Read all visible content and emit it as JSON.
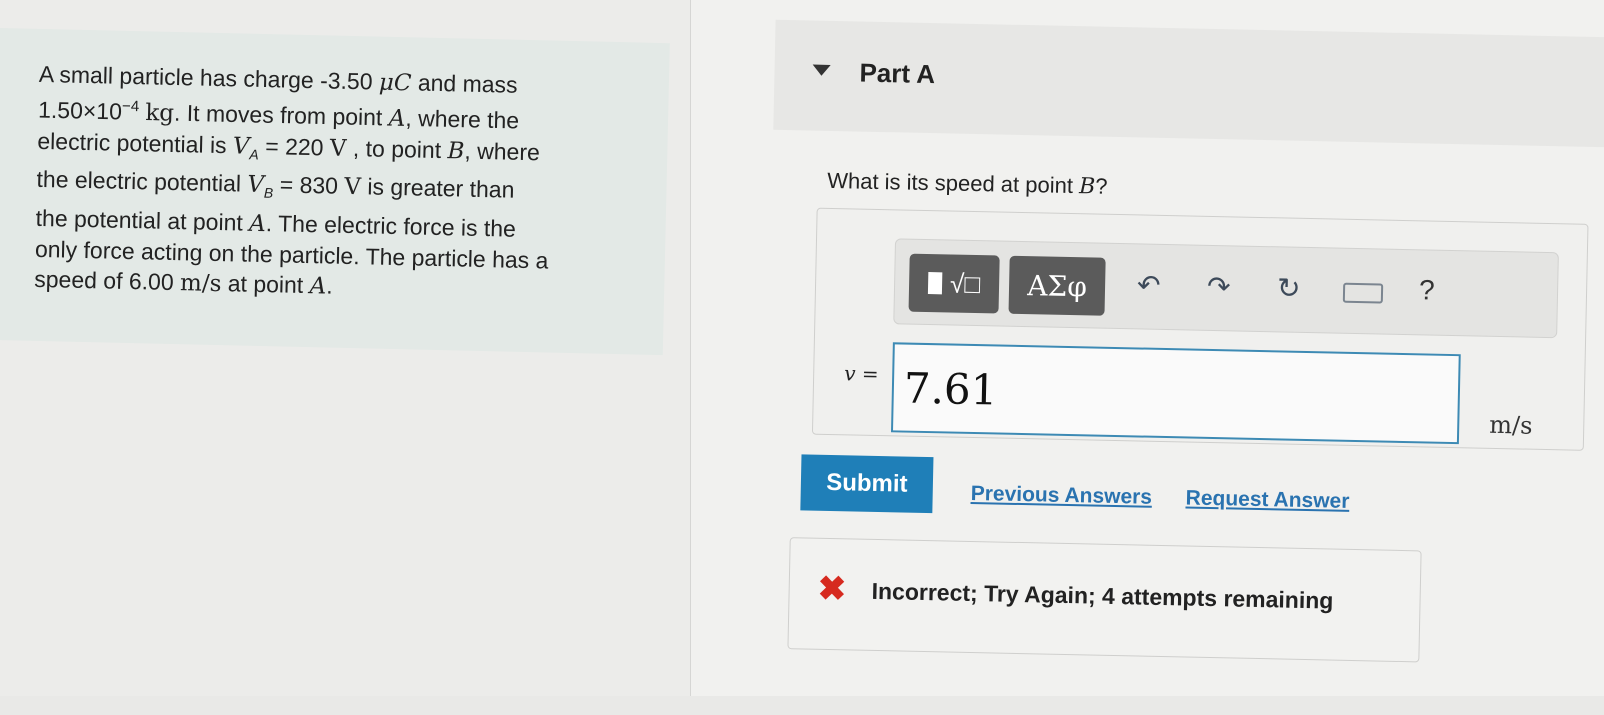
{
  "problem": {
    "line1": "A small particle has charge -3.50 ",
    "line1_unit": "μC",
    "line1_end": " and mass",
    "mass_value": "1.50×10",
    "mass_exp": "−4",
    "mass_unit": "kg",
    "line2_end": ". It moves from point ",
    "point_a": "A",
    "line2_tail": ", where the",
    "line3": "electric potential is ",
    "va_sym": "V",
    "va_sub": "A",
    "va_val": " = 220 ",
    "va_unit": "V",
    "line3_tail": " , to point ",
    "point_b": "B",
    "line3_end": ", where",
    "line4": "the electric potential ",
    "vb_sym": "V",
    "vb_sub": "B",
    "vb_val": " = 830 ",
    "vb_unit": "V",
    "line4_tail": " is greater than",
    "line5": "the potential at point ",
    "point_a2": "A",
    "line5_tail": ". The electric force is the",
    "line6": "only force acting on the particle. The particle has a",
    "line7": "speed of 6.00 ",
    "speed_unit": "m/s",
    "line7_tail": " at point ",
    "point_a3": "A",
    "line7_end": "."
  },
  "part": {
    "title": "Part A"
  },
  "question": {
    "text": "What is its speed at point ",
    "point": "B",
    "end": "?"
  },
  "toolbar": {
    "templates_icon": "√□",
    "greek_label": "ΑΣφ",
    "undo_icon": "↶",
    "redo_icon": "↷",
    "reset_icon": "↻",
    "help_label": "?"
  },
  "answer": {
    "variable": "v",
    "equals": " =",
    "value": "7.61",
    "unit": "m/s"
  },
  "actions": {
    "submit": "Submit",
    "previous": "Previous Answers",
    "request": "Request Answer"
  },
  "feedback": {
    "icon": "✖",
    "text": "Incorrect; Try Again; 4 attempts remaining"
  },
  "colors": {
    "accent": "#1f7fb8",
    "error": "#d62a1f",
    "input_border": "#3d8ab4"
  }
}
